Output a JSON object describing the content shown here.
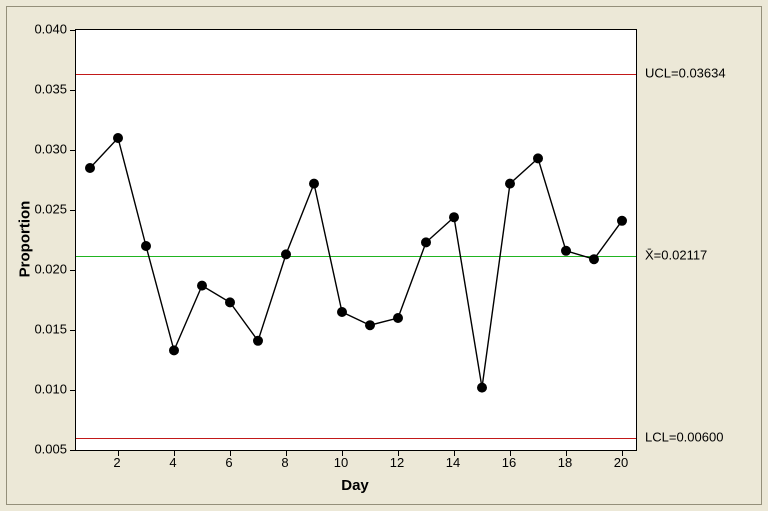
{
  "chart_data": {
    "type": "line",
    "xlabel": "Day",
    "ylabel": "Proportion",
    "x": [
      1,
      2,
      3,
      4,
      5,
      6,
      7,
      8,
      9,
      10,
      11,
      12,
      13,
      14,
      15,
      16,
      17,
      18,
      19,
      20
    ],
    "values": [
      0.0285,
      0.031,
      0.022,
      0.0133,
      0.0187,
      0.0173,
      0.0141,
      0.0213,
      0.0272,
      0.0165,
      0.0154,
      0.016,
      0.0223,
      0.0244,
      0.0102,
      0.0272,
      0.0293,
      0.0216,
      0.0209,
      0.0241
    ],
    "ylim": [
      0.005,
      0.04
    ],
    "xlim": [
      1,
      20
    ],
    "x_ticks": [
      2,
      4,
      6,
      8,
      10,
      12,
      14,
      16,
      18,
      20
    ],
    "y_ticks": [
      0.005,
      0.01,
      0.015,
      0.02,
      0.025,
      0.03,
      0.035,
      0.04
    ],
    "reference_lines": {
      "ucl": {
        "value": 0.03634,
        "label": "UCL=0.03634",
        "color": "red"
      },
      "mean": {
        "value": 0.02117,
        "label": "X̄=0.02117",
        "color": "green"
      },
      "lcl": {
        "value": 0.006,
        "label": "LCL=0.00600",
        "color": "red"
      }
    }
  }
}
